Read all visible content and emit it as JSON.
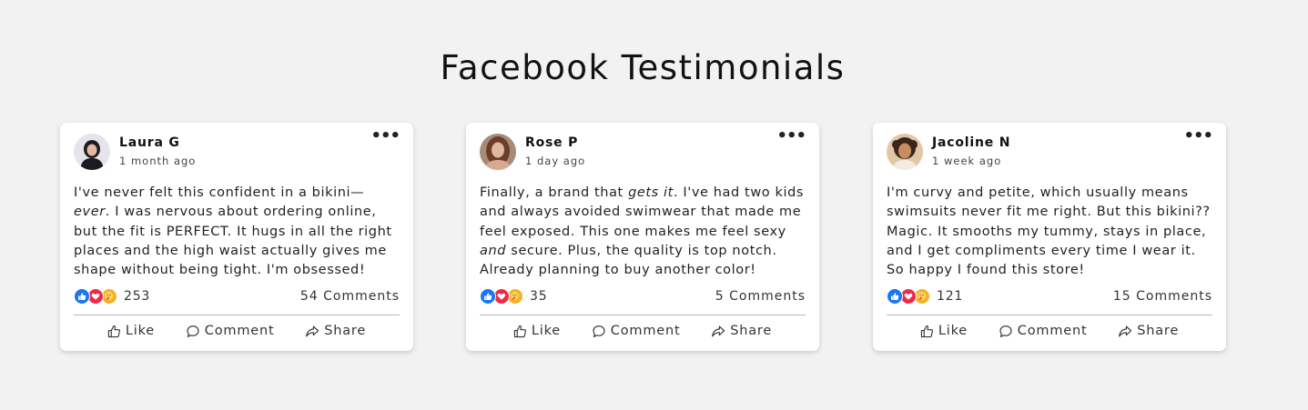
{
  "page": {
    "title": "Facebook Testimonials"
  },
  "colors": {
    "background": "#f2f2f2",
    "card": "#ffffff",
    "like": "#1877f2",
    "love": "#f02849",
    "care": "#f7b125"
  },
  "icons": {
    "menu": "ellipsis-icon",
    "reactions": [
      "like-reaction-icon",
      "love-reaction-icon",
      "care-reaction-icon"
    ],
    "actions": [
      "thumbs-up-icon",
      "speech-bubble-icon",
      "share-arrow-icon"
    ]
  },
  "actions": {
    "like": "Like",
    "comment": "Comment",
    "share": "Share",
    "menu_glyph": "•••"
  },
  "cards": [
    {
      "name": "Laura G",
      "time": "1 month ago",
      "text_parts": [
        "I've never felt this confident in a bikini—",
        "ever",
        ". I was nervous about ordering online, but the fit is PERFECT. It hugs in all the right places and the high waist actually gives me shape without being tight. I'm obsessed!"
      ],
      "reactions": "253",
      "comments": "54 Comments"
    },
    {
      "name": "Rose P",
      "time": "1 day ago",
      "text_parts": [
        "Finally, a brand that ",
        "gets it",
        ". I've had two kids and always avoided swimwear that made me feel exposed. This one makes me feel sexy ",
        "and",
        " secure. Plus, the quality is top notch. Already planning to buy another color!"
      ],
      "reactions": "35",
      "comments": "5 Comments"
    },
    {
      "name": "Jacoline N",
      "time": "1 week ago",
      "text_parts": [
        "I'm curvy and petite, which usually means swimsuits never fit me right. But this bikini?? Magic. It smooths my tummy, stays in place, and I get compliments every time I wear it. So happy I found this store!"
      ],
      "reactions": "121",
      "comments": "15 Comments"
    }
  ]
}
